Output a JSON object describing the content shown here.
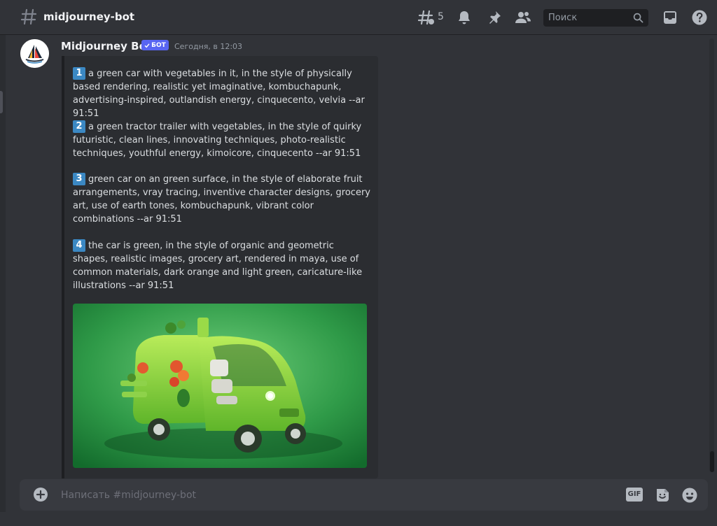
{
  "header": {
    "channel_name": "midjourney-bot",
    "threads_count": "5",
    "search_placeholder": "Поиск"
  },
  "message": {
    "author": "Midjourney Bot",
    "bot_tag": "БОТ",
    "timestamp": "Сегодня, в 12:03",
    "prompts": [
      {
        "number": "1",
        "text": "a green car with vegetables in it, in the style of physically based rendering, realistic yet imaginative, kombuchapunk, advertising-inspired, outlandish energy, cinquecento, velvia --ar 91:51"
      },
      {
        "number": "2",
        "text": "a green tractor trailer with vegetables, in the style of quirky futuristic, clean lines, innovating techniques, photo-realistic techniques, youthful energy, kimoicore, cinquecento --ar 91:51"
      },
      {
        "number": "3",
        "text": "green car on an green surface, in the style of elaborate fruit arrangements, vray tracing, inventive character designs, grocery art, use of earth tones, kombuchapunk, vibrant color combinations --ar 91:51"
      },
      {
        "number": "4",
        "text": "the car is green, in the style of organic and geometric shapes, realistic images, grocery art, rendered in maya, use of common materials, dark orange and light green, caricature-like illustrations --ar 91:51"
      }
    ]
  },
  "composer": {
    "placeholder": "Написать #midjourney-bot",
    "gif_label": "GIF"
  },
  "colors": {
    "background": "#313338",
    "embed": "#2b2d31",
    "bot_tag": "#5865f2",
    "number_badge": "#3b88c3",
    "composer": "#383a40"
  }
}
